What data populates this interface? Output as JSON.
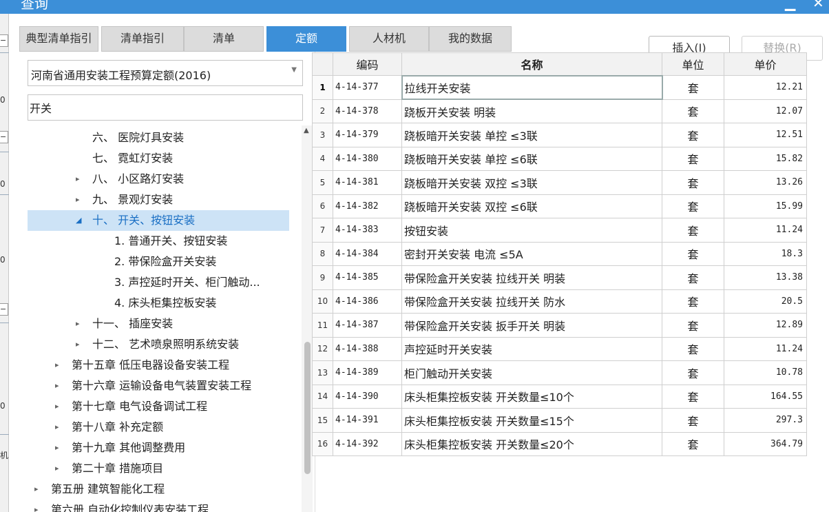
{
  "window": {
    "title": "查询",
    "minimize": "▁",
    "close": "✕"
  },
  "left_strip": {
    "marks": [
      "−",
      "0",
      "−",
      "0",
      "0",
      "−",
      "0"
    ],
    "label": "机"
  },
  "tabs": [
    {
      "label": "典型清单指引",
      "active": false
    },
    {
      "label": "清单指引",
      "active": false
    },
    {
      "label": "清单",
      "active": false
    },
    {
      "label": "定额",
      "active": true
    },
    {
      "label": "人材机",
      "active": false
    },
    {
      "label": "我的数据",
      "active": false
    }
  ],
  "buttons": {
    "insert": "插入(I)",
    "replace": "替换(R)"
  },
  "library_select": {
    "value": "河南省通用安装工程预算定额(2016)",
    "arrow_icon": "chevron-down-icon"
  },
  "search": {
    "value": "开关",
    "placeholder": ""
  },
  "tree": [
    {
      "label": "六、 医院灯具安装",
      "expand": ""
    },
    {
      "label": "七、 霓虹灯安装",
      "expand": ""
    },
    {
      "label": "八、 小区路灯安装",
      "expand": "▸"
    },
    {
      "label": "九、 景观灯安装",
      "expand": "▸"
    },
    {
      "label": "十、 开关、按钮安装",
      "expand": "◢",
      "selected": true
    },
    {
      "label": "1. 普通开关、按钮安装",
      "expand": ""
    },
    {
      "label": "2. 带保险盒开关安装",
      "expand": ""
    },
    {
      "label": "3. 声控延时开关、柜门触动...",
      "expand": ""
    },
    {
      "label": "4. 床头柜集控板安装",
      "expand": ""
    },
    {
      "label": "十一、 插座安装",
      "expand": "▸"
    },
    {
      "label": "十二、 艺术喷泉照明系统安装",
      "expand": "▸"
    },
    {
      "label": "第十五章 低压电器设备安装工程",
      "expand": "▸"
    },
    {
      "label": "第十六章 运输设备电气装置安装工程",
      "expand": "▸"
    },
    {
      "label": "第十七章 电气设备调试工程",
      "expand": "▸"
    },
    {
      "label": "第十八章 补充定额",
      "expand": "▸"
    },
    {
      "label": "第十九章 其他调整费用",
      "expand": "▸"
    },
    {
      "label": "第二十章 措施项目",
      "expand": "▸"
    },
    {
      "label": "第五册 建筑智能化工程",
      "expand": "▸"
    },
    {
      "label": "第六册 自动化控制仪表安装工程",
      "expand": "▸"
    }
  ],
  "table": {
    "headers": {
      "index": "",
      "code": "编码",
      "name": "名称",
      "unit": "单位",
      "price": "单价"
    },
    "rows": [
      {
        "idx": "1",
        "code": "4-14-377",
        "name": "拉线开关安装",
        "unit": "套",
        "price": "12.21"
      },
      {
        "idx": "2",
        "code": "4-14-378",
        "name": "跷板开关安装 明装",
        "unit": "套",
        "price": "12.07"
      },
      {
        "idx": "3",
        "code": "4-14-379",
        "name": "跷板暗开关安装 单控 ≤3联",
        "unit": "套",
        "price": "12.51"
      },
      {
        "idx": "4",
        "code": "4-14-380",
        "name": "跷板暗开关安装 单控 ≤6联",
        "unit": "套",
        "price": "15.82"
      },
      {
        "idx": "5",
        "code": "4-14-381",
        "name": "跷板暗开关安装 双控 ≤3联",
        "unit": "套",
        "price": "13.26"
      },
      {
        "idx": "6",
        "code": "4-14-382",
        "name": "跷板暗开关安装 双控 ≤6联",
        "unit": "套",
        "price": "15.99"
      },
      {
        "idx": "7",
        "code": "4-14-383",
        "name": "按钮安装",
        "unit": "套",
        "price": "11.24"
      },
      {
        "idx": "8",
        "code": "4-14-384",
        "name": "密封开关安装 电流 ≤5A",
        "unit": "套",
        "price": "18.3"
      },
      {
        "idx": "9",
        "code": "4-14-385",
        "name": "带保险盒开关安装 拉线开关 明装",
        "unit": "套",
        "price": "13.38"
      },
      {
        "idx": "10",
        "code": "4-14-386",
        "name": "带保险盒开关安装 拉线开关 防水",
        "unit": "套",
        "price": "20.5"
      },
      {
        "idx": "11",
        "code": "4-14-387",
        "name": "带保险盒开关安装 扳手开关 明装",
        "unit": "套",
        "price": "12.89"
      },
      {
        "idx": "12",
        "code": "4-14-388",
        "name": "声控延时开关安装",
        "unit": "套",
        "price": "11.24"
      },
      {
        "idx": "13",
        "code": "4-14-389",
        "name": "柜门触动开关安装",
        "unit": "套",
        "price": "10.78"
      },
      {
        "idx": "14",
        "code": "4-14-390",
        "name": "床头柜集控板安装 开关数量≤10个",
        "unit": "套",
        "price": "164.55"
      },
      {
        "idx": "15",
        "code": "4-14-391",
        "name": "床头柜集控板安装 开关数量≤15个",
        "unit": "套",
        "price": "297.3"
      },
      {
        "idx": "16",
        "code": "4-14-392",
        "name": "床头柜集控板安装 开关数量≤20个",
        "unit": "套",
        "price": "364.79"
      }
    ]
  }
}
